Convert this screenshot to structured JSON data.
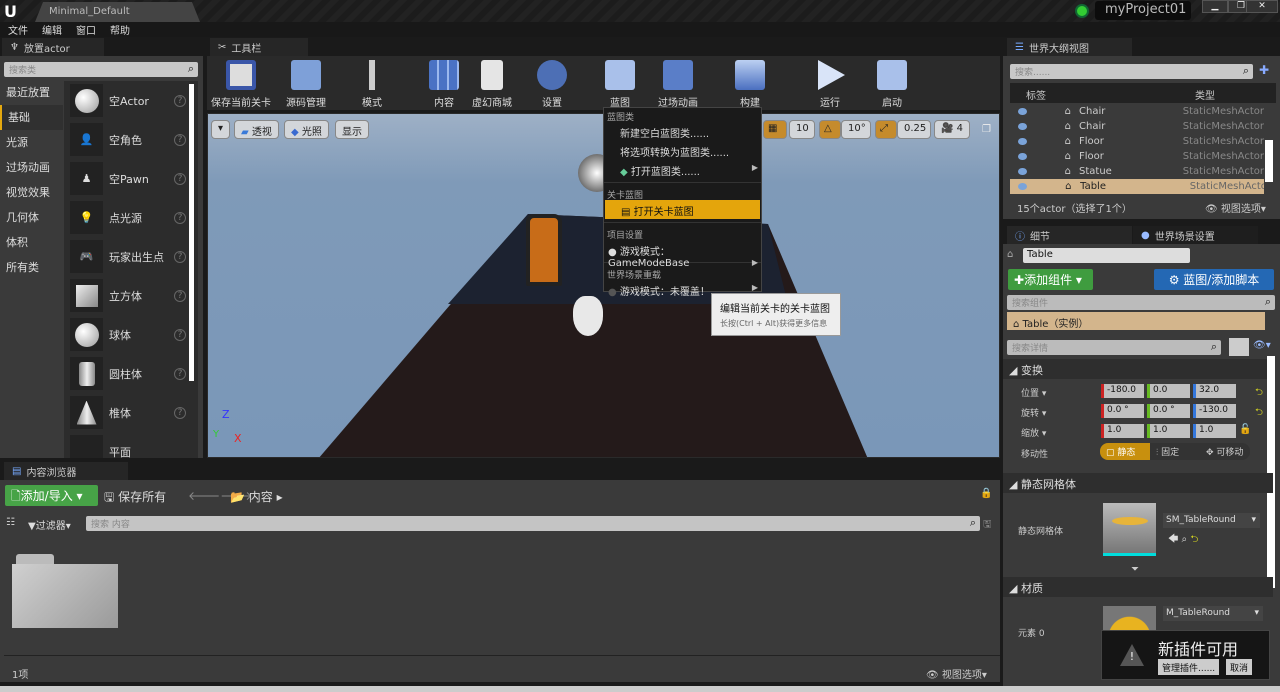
{
  "window": {
    "doc_tab": "Minimal_Default",
    "project": "myProject01",
    "minimize": "▁",
    "restore": "❐",
    "close": "✕"
  },
  "menu": [
    "文件",
    "编辑",
    "窗口",
    "帮助"
  ],
  "place_panel": {
    "tab": "放置actor",
    "search_placeholder": "搜索类",
    "categories": [
      "最近放置",
      "基础",
      "光源",
      "过场动画",
      "视觉效果",
      "几何体",
      "体积",
      "所有类"
    ],
    "selected_category": "基础",
    "items": [
      "空Actor",
      "空角色",
      "空Pawn",
      "点光源",
      "玩家出生点",
      "立方体",
      "球体",
      "圆柱体",
      "椎体",
      "平面"
    ]
  },
  "toolbar": {
    "tab": "工具栏",
    "buttons": [
      "保存当前关卡",
      "源码管理",
      "模式",
      "内容",
      "虚幻商城",
      "设置",
      "蓝图",
      "过场动画",
      "构建",
      "运行",
      "启动"
    ]
  },
  "viewport": {
    "dropdown": "▾",
    "perspective": "透视",
    "lighting": "光照",
    "show": "显示",
    "grid_snap": "10",
    "rot_snap": "10°",
    "scale_snap": "0.25",
    "cam_speed": "4",
    "axis_z": "Z",
    "axis_y": "Y",
    "axis_x": "X"
  },
  "blueprint_menu": {
    "section1": "蓝图类",
    "items1": [
      "新建空白蓝图类......",
      "将选项转换为蓝图类......",
      "打开蓝图类......"
    ],
    "section2": "关卡蓝图",
    "open_level_bp": "打开关卡蓝图",
    "section3": "项目设置",
    "game_mode": "游戏模式：GameModeBase",
    "section4": "世界场景重载",
    "game_mode_override": "游戏模式：未覆盖！"
  },
  "tooltip": {
    "title": "编辑当前关卡的关卡蓝图",
    "hint": "长按(Ctrl + Alt)获得更多信息"
  },
  "outliner": {
    "tab": "世界大纲视图",
    "search_placeholder": "搜索......",
    "col_label": "标签",
    "col_type": "类型",
    "rows": [
      {
        "label": "Chair",
        "type": "StaticMeshActor"
      },
      {
        "label": "Chair",
        "type": "StaticMeshActor"
      },
      {
        "label": "Floor",
        "type": "StaticMeshActor"
      },
      {
        "label": "Floor",
        "type": "StaticMeshActor"
      },
      {
        "label": "Statue",
        "type": "StaticMeshActor"
      },
      {
        "label": "Table",
        "type": "StaticMeshActor",
        "selected": true
      }
    ],
    "count": "15个actor（选择了1个）",
    "view_options": "视图选项"
  },
  "details": {
    "tab": "细节",
    "tab2": "世界场景设置",
    "name": "Table",
    "add_component": "添加组件",
    "blueprint_btn": "蓝图/添加脚本",
    "search_components": "搜索组件",
    "component": "Table（实例）",
    "search_details": "搜索详情",
    "transform": "变换",
    "location_label": "位置",
    "location": [
      "-180.0",
      "0.0",
      "32.0"
    ],
    "rotation_label": "旋转",
    "rotation": [
      "0.0 °",
      "0.0 °",
      "-130.0"
    ],
    "scale_label": "缩放",
    "scale": [
      "1.0",
      "1.0",
      "1.0"
    ],
    "mobility_label": "移动性",
    "mobility": [
      "静态",
      "固定",
      "可移动"
    ],
    "static_mesh_section": "静态网格体",
    "static_mesh_label": "静态网格体",
    "static_mesh": "SM_TableRound",
    "material_section": "材质",
    "element_label": "元素 0",
    "material": "M_TableRound"
  },
  "notification": {
    "title": "新插件可用",
    "manage": "管理插件......",
    "cancel": "取消"
  },
  "content_browser": {
    "tab": "内容浏览器",
    "add_import": "添加/导入",
    "save_all": "保存所有",
    "path": "内容",
    "filters": "过滤器",
    "search_placeholder": "搜索 内容",
    "count": "1项",
    "view_options": "视图选项"
  }
}
